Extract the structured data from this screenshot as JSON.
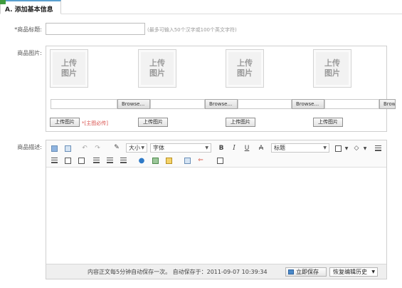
{
  "header": {
    "title": "A. 添加基本信息"
  },
  "form": {
    "name_label": "*商品标题:",
    "name_value": "",
    "name_hint": "(最多可输入50个汉字或100个英文字符)",
    "images_label": "商品图片:",
    "thumb_text": "上传\n图片",
    "browse_label": "Browse...",
    "upload_label": "上传图片",
    "required_note": "*[主图必传]",
    "desc_label": "商品描述:"
  },
  "editor": {
    "size_select": "大小",
    "font_select": "字体",
    "heading_select": "标题",
    "status_text": "内容正文每5分钟自动保存一次。 自动保存于：2011-09-07 10:39:34",
    "save_now_label": "立即保存",
    "restore_label": "恢复编辑历史"
  }
}
